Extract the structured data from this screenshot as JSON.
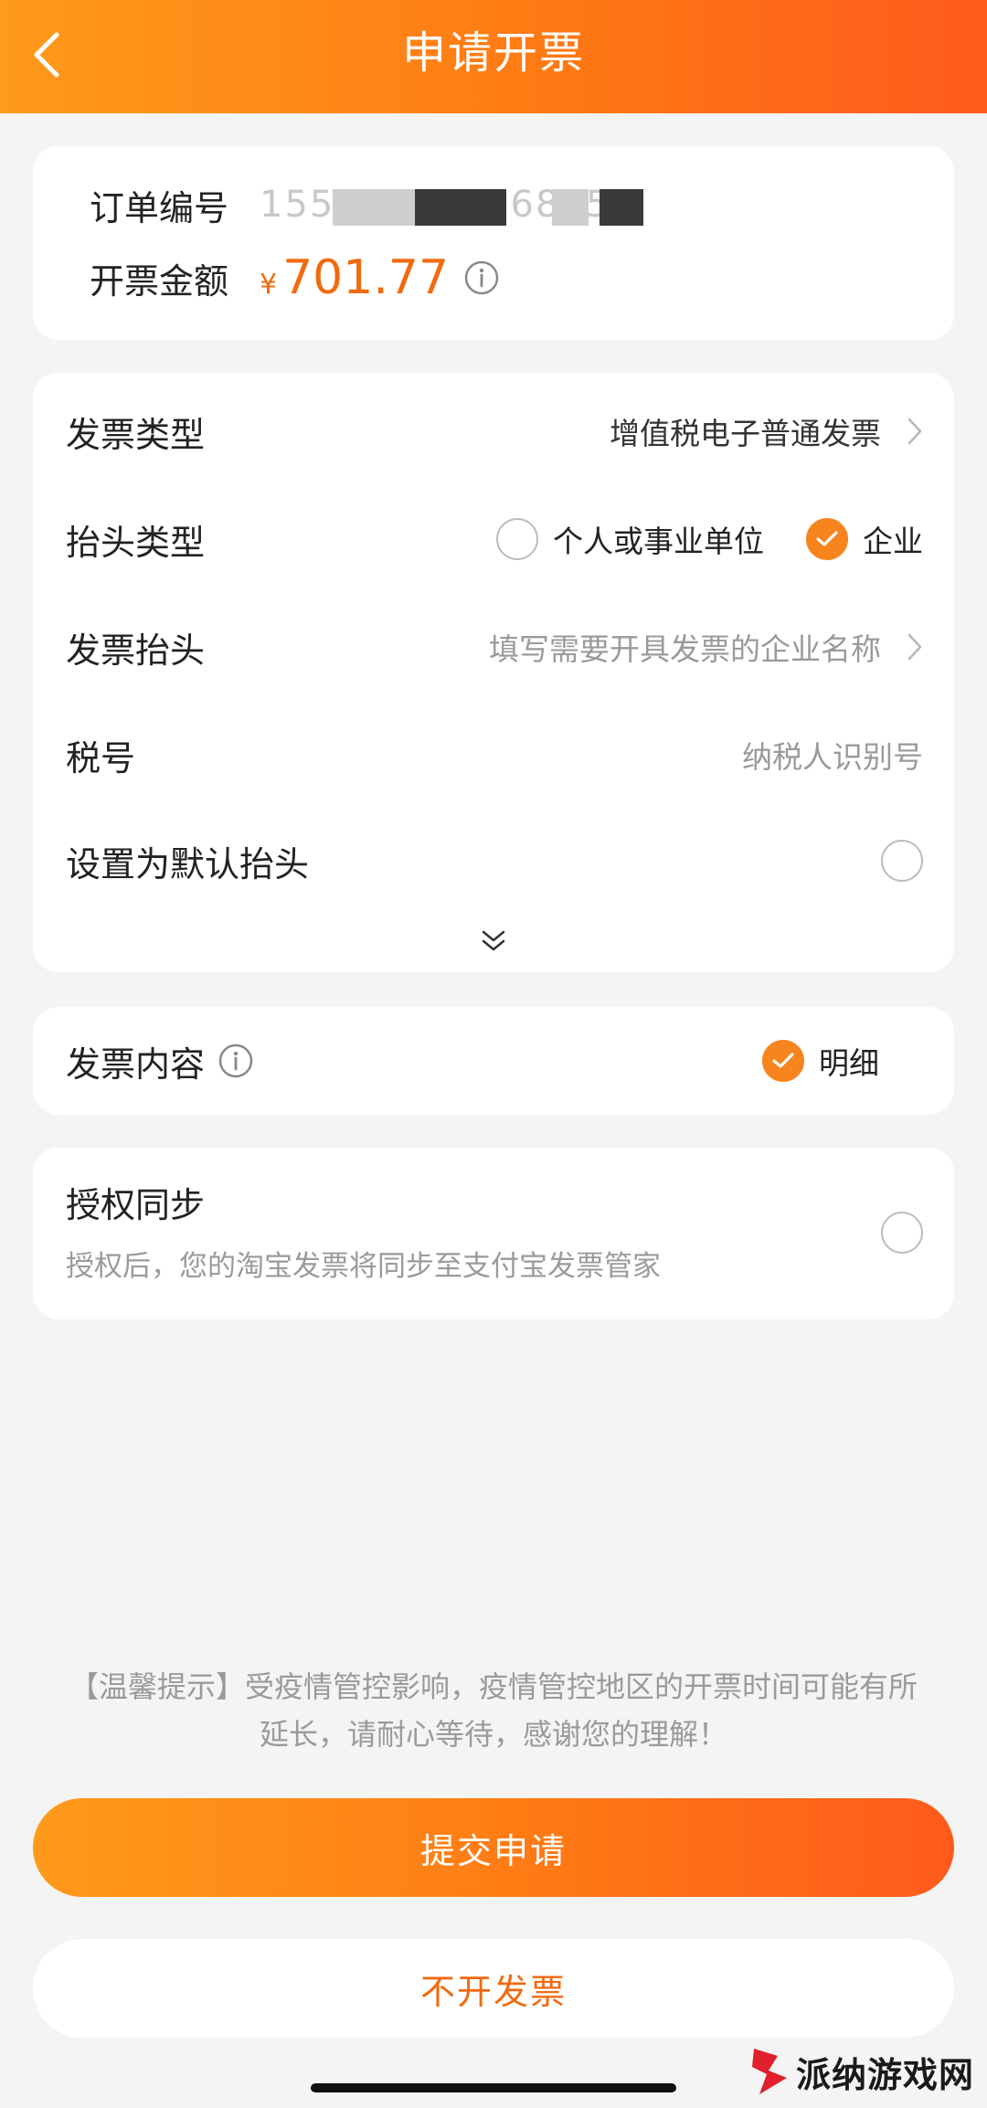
{
  "header": {
    "title": "申请开票"
  },
  "order": {
    "number_label": "订单编号",
    "number_value": "1557154691681532",
    "amount_label": "开票金额",
    "amount_currency": "¥",
    "amount_value": "701.77"
  },
  "invoice": {
    "type_label": "发票类型",
    "type_value": "增值税电子普通发票",
    "title_type_label": "抬头类型",
    "title_type_options": [
      "个人或事业单位",
      "企业"
    ],
    "title_type_selected": "企业",
    "title_label": "发票抬头",
    "title_placeholder": "填写需要开具发票的企业名称",
    "tax_label": "税号",
    "tax_placeholder": "纳税人识别号",
    "default_label": "设置为默认抬头"
  },
  "content": {
    "label": "发票内容",
    "option": "明细"
  },
  "auth": {
    "title": "授权同步",
    "description": "授权后，您的淘宝发票将同步至支付宝发票管家"
  },
  "notice": {
    "line1": "【温馨提示】受疫情管控影响，疫情管控地区的开票时间可能有所",
    "line2": "延长，请耐心等待，感谢您的理解！"
  },
  "actions": {
    "submit_label": "提交申请",
    "skip_label": "不开发票"
  },
  "watermark": {
    "text": "派纳游戏网"
  },
  "colors": {
    "accent": "#f7841d",
    "amount": "#f06a10"
  }
}
